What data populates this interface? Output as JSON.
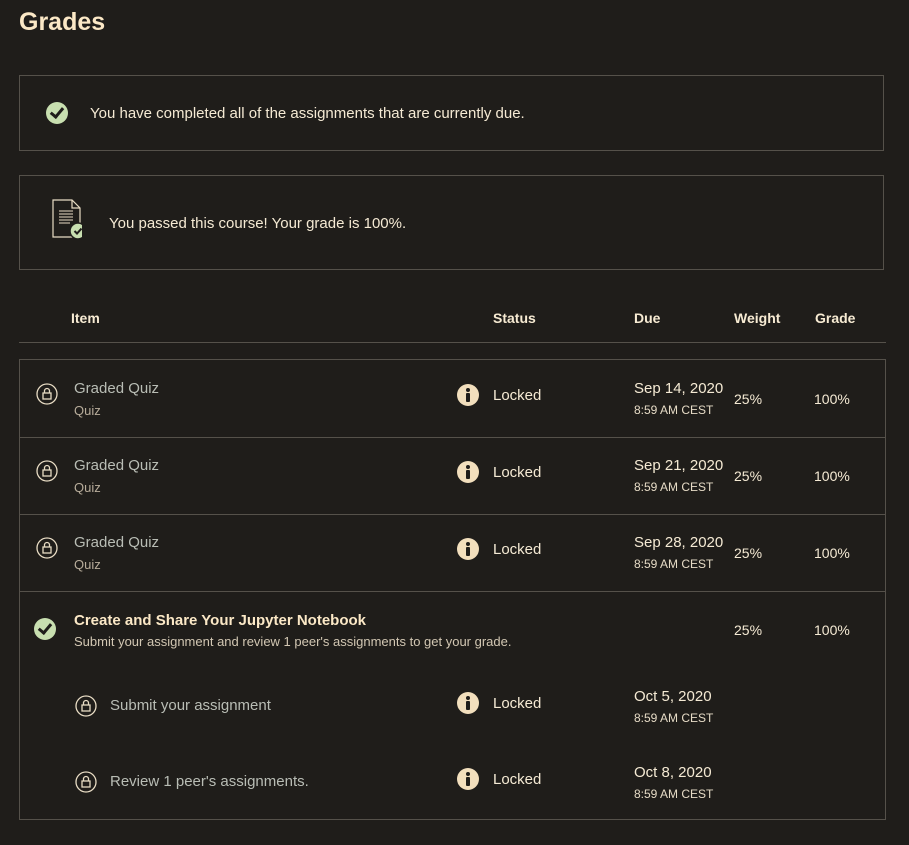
{
  "page": {
    "title": "Grades"
  },
  "alerts": {
    "completed": "You have completed all of the assignments that are currently due.",
    "passed": "You passed this course! Your grade is 100%."
  },
  "table": {
    "headers": {
      "item": "Item",
      "status": "Status",
      "due": "Due",
      "weight": "Weight",
      "grade": "Grade"
    },
    "rows": [
      {
        "name": "Graded Quiz",
        "type": "Quiz",
        "status": "Locked",
        "due_date": "Sep 14, 2020",
        "due_time": "8:59 AM CEST",
        "weight": "25%",
        "grade": "100%"
      },
      {
        "name": "Graded Quiz",
        "type": "Quiz",
        "status": "Locked",
        "due_date": "Sep 21, 2020",
        "due_time": "8:59 AM CEST",
        "weight": "25%",
        "grade": "100%"
      },
      {
        "name": "Graded Quiz",
        "type": "Quiz",
        "status": "Locked",
        "due_date": "Sep 28, 2020",
        "due_time": "8:59 AM CEST",
        "weight": "25%",
        "grade": "100%"
      }
    ],
    "project": {
      "title": "Create and Share Your Jupyter Notebook",
      "description": "Submit your assignment and review 1 peer's assignments to get your grade.",
      "weight": "25%",
      "grade": "100%",
      "subitems": [
        {
          "name": "Submit your assignment",
          "status": "Locked",
          "due_date": "Oct 5, 2020",
          "due_time": "8:59 AM CEST"
        },
        {
          "name": "Review 1 peer's assignments.",
          "status": "Locked",
          "due_date": "Oct 8, 2020",
          "due_time": "8:59 AM CEST"
        }
      ]
    }
  },
  "icons": {
    "check": "check-circle-icon",
    "document": "document-check-icon",
    "lock": "lock-icon",
    "info": "info-icon"
  },
  "colors": {
    "background": "#1f1d1a",
    "accent_green": "#c8dfb0",
    "text": "#f2e6cf"
  }
}
